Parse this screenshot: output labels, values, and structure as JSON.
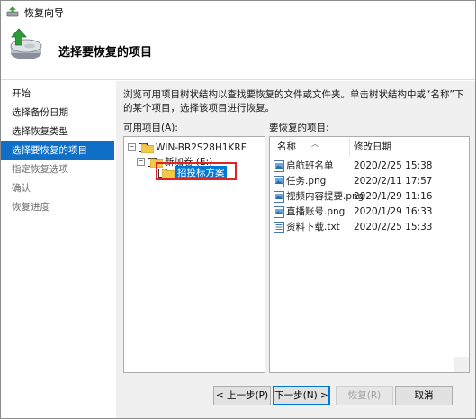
{
  "window": {
    "title": "恢复向导"
  },
  "header": {
    "title": "选择要恢复的项目"
  },
  "nav": {
    "items": [
      {
        "label": "开始",
        "state": "normal"
      },
      {
        "label": "选择备份日期",
        "state": "normal"
      },
      {
        "label": "选择恢复类型",
        "state": "normal"
      },
      {
        "label": "选择要恢复的项目",
        "state": "active"
      },
      {
        "label": "指定恢复选项",
        "state": "disabled"
      },
      {
        "label": "确认",
        "state": "disabled"
      },
      {
        "label": "恢复进度",
        "state": "disabled"
      }
    ]
  },
  "content": {
    "description": "浏览可用项目树状结构以查找要恢复的文件或文件夹。单击树状结构中或“名称”下的某个项目，选择该项目进行恢复。",
    "available_label": "可用项目(A):",
    "restore_label": "要恢复的项目:"
  },
  "tree": {
    "nodes": [
      {
        "label": "WIN-BR2S28H1KRF",
        "expander": "−",
        "level": 0
      },
      {
        "label": "新加卷 (E:)",
        "expander": "−",
        "level": 1
      },
      {
        "label": "招投标方案",
        "expander": "",
        "level": 2,
        "selected": true
      }
    ]
  },
  "filelist": {
    "columns": [
      "名称",
      "修改日期"
    ],
    "rows": [
      {
        "name": "启航班名单",
        "date": "2020/2/25 15:38",
        "icon": "image-file-icon"
      },
      {
        "name": "任务.png",
        "date": "2020/2/11 17:57",
        "icon": "image-file-icon"
      },
      {
        "name": "视频内容提要.png",
        "date": "2020/1/29 11:16",
        "icon": "image-file-icon"
      },
      {
        "name": "直播账号.png",
        "date": "2020/1/29 16:33",
        "icon": "image-file-icon"
      },
      {
        "name": "资料下载.txt",
        "date": "2020/2/25 15:33",
        "icon": "text-file-icon"
      }
    ]
  },
  "buttons": {
    "prev": "< 上一步(P)",
    "next": "下一步(N) >",
    "restore": "恢复(R)",
    "cancel": "取消"
  },
  "colors": {
    "accent": "#0f6fc6",
    "selection": "#0078d7",
    "highlight_box": "#e02424"
  }
}
